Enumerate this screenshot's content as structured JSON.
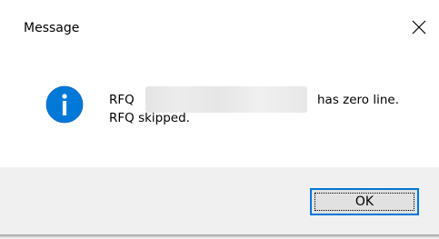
{
  "dialog": {
    "title": "Message",
    "message": {
      "prefix": "RFQ",
      "line1_suffix": "has zero line.",
      "line2": "RFQ skipped."
    },
    "ok_label": "OK"
  },
  "icons": {
    "close": "close-icon",
    "info": "info-icon"
  },
  "colors": {
    "info_blue": "#0078d7",
    "footer_bg": "#f0f0f0",
    "button_bg": "#e1e1e1",
    "button_border": "#0078d7"
  }
}
